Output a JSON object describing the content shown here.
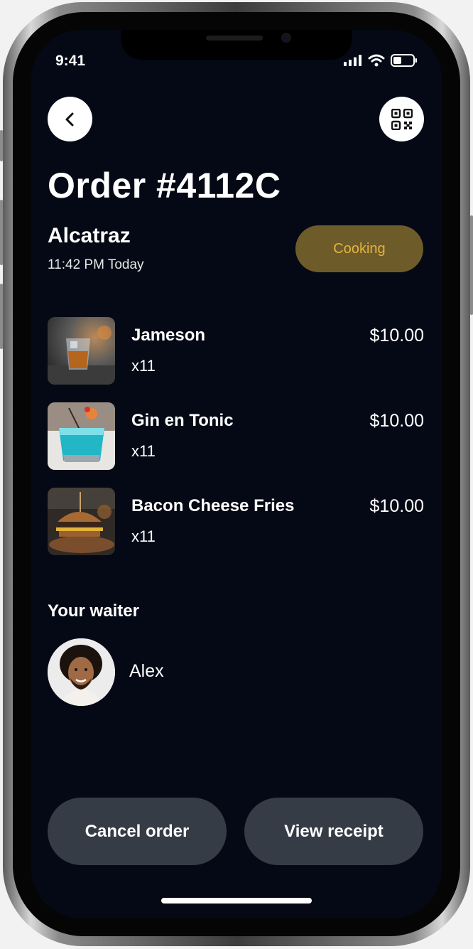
{
  "status_bar": {
    "time": "9:41"
  },
  "header": {
    "back_icon": "chevron-left-icon",
    "qr_icon": "qr-code-icon"
  },
  "order": {
    "title": "Order #4112C",
    "venue": "Alcatraz",
    "time": "11:42 PM Today",
    "status": "Cooking"
  },
  "items": [
    {
      "name": "Jameson",
      "qty": "x11",
      "price": "$10.00"
    },
    {
      "name": "Gin en Tonic",
      "qty": "x11",
      "price": "$10.00"
    },
    {
      "name": "Bacon Cheese Fries",
      "qty": "x11",
      "price": "$10.00"
    }
  ],
  "waiter": {
    "heading": "Your waiter",
    "name": "Alex"
  },
  "actions": {
    "cancel": "Cancel order",
    "receipt": "View receipt"
  },
  "colors": {
    "background": "#040915",
    "status_pill": "#6e5b2a",
    "status_text": "#e3b43f",
    "button": "#363c46"
  }
}
